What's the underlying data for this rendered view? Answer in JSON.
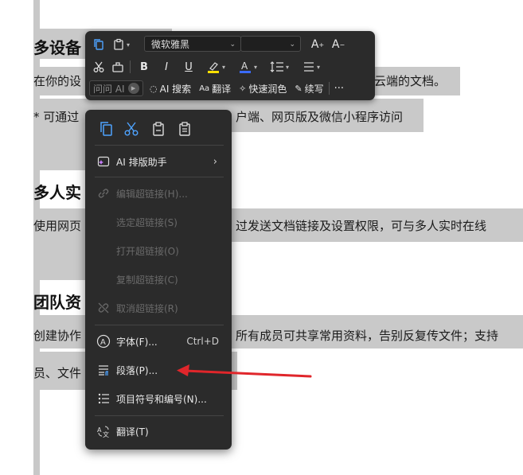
{
  "document": {
    "heading1": "多设备",
    "line1_left": "在你的设",
    "line1_right": "云端的文档。",
    "line2_left": "* 可通过",
    "line2_right": "户端、网页版及微信小程序访问",
    "heading2": "多人实",
    "line3_left": "使用网页",
    "line3_right": "过发送文档链接及设置权限，可与多人实时在线",
    "heading3": "团队资",
    "line4_left": "创建协作",
    "line4_right": "所有成员可共享常用资料，告别反复传文件；支持",
    "line5_left": "员、文件"
  },
  "toolbar": {
    "font_name": "微软雅黑",
    "font_size": "",
    "bold": "B",
    "italic": "I",
    "underline": "U",
    "ask_ai": "问问 AI",
    "ai_search": "AI 搜索",
    "translate": "翻译",
    "polish": "快速润色",
    "continue_write": "续写",
    "more": "···"
  },
  "menu": {
    "ai_layout": "AI 排版助手",
    "edit_link": "编辑超链接(H)...",
    "select_link": "选定超链接(S)",
    "open_link": "打开超链接(O)",
    "copy_link": "复制超链接(C)",
    "remove_link": "取消超链接(R)",
    "font": "字体(F)...",
    "font_shortcut": "Ctrl+D",
    "paragraph": "段落(P)...",
    "bullets": "项目符号和编号(N)...",
    "translate": "翻译(T)"
  },
  "colors": {
    "highlight_yellow": "#ffe000",
    "font_color_blue": "#3a6bff",
    "annotation_red": "#e0262b"
  }
}
